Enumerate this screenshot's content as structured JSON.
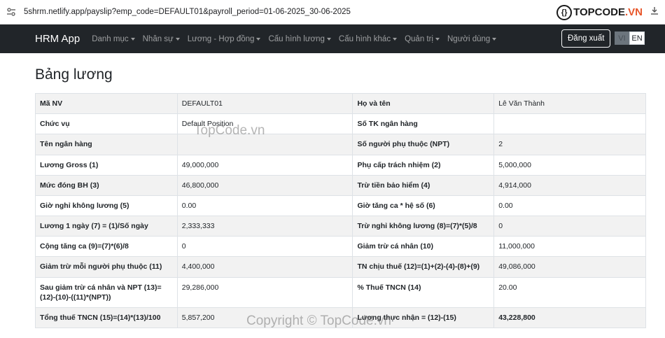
{
  "browser": {
    "url": "5shrm.netlify.app/payslip?emp_code=DEFAULT01&payroll_period=01-06-2025_30-06-2025"
  },
  "topcode_logo": {
    "text1": "TOPCODE",
    "text2": ".VN"
  },
  "navbar": {
    "brand": "HRM App",
    "items": [
      {
        "label": "Danh mục"
      },
      {
        "label": "Nhân sự"
      },
      {
        "label": "Lương - Hợp đồng"
      },
      {
        "label": "Cấu hình lương"
      },
      {
        "label": "Cấu hình khác"
      },
      {
        "label": "Quản trị"
      },
      {
        "label": "Người dùng"
      }
    ],
    "logout": "Đăng xuất",
    "lang_vi": "VI",
    "lang_en": "EN"
  },
  "page": {
    "title": "Bảng lương",
    "rows": [
      {
        "k1": "Mã NV",
        "v1": "DEFAULT01",
        "k2": "Họ và tên",
        "v2": "Lê Văn Thành"
      },
      {
        "k1": "Chức vụ",
        "v1": "Default Position",
        "k2": "Số TK ngân hàng",
        "v2": ""
      },
      {
        "k1": "Tên ngân hàng",
        "v1": "",
        "k2": "Số người phụ thuộc (NPT)",
        "v2": "2"
      },
      {
        "k1": "Lương Gross (1)",
        "v1": "49,000,000",
        "k2": "Phụ cấp trách nhiệm (2)",
        "v2": "5,000,000"
      },
      {
        "k1": "Mức đóng BH (3)",
        "v1": "46,800,000",
        "k2": "Trừ tiền bảo hiểm (4)",
        "v2": "4,914,000"
      },
      {
        "k1": "Giờ nghỉ không lương (5)",
        "v1": "0.00",
        "k2": "Giờ tăng ca * hệ số (6)",
        "v2": "0.00"
      },
      {
        "k1": "Lương 1 ngày (7) = (1)/Số ngày",
        "v1": "2,333,333",
        "k2": "Trừ nghỉ không lương (8)=(7)*(5)/8",
        "v2": "0"
      },
      {
        "k1": "Cộng tăng ca (9)=(7)*(6)/8",
        "v1": "0",
        "k2": "Giảm trừ cá nhân (10)",
        "v2": "11,000,000"
      },
      {
        "k1": "Giảm trừ mỗi người phụ thuộc (11)",
        "v1": "4,400,000",
        "k2": "TN chịu thuế (12)=(1)+(2)-(4)-(8)+(9)",
        "v2": "49,086,000"
      },
      {
        "k1": "Sau giảm trừ cá nhân và NPT (13)=(12)-(10)-((11)*(NPT))",
        "v1": "29,286,000",
        "k2": "% Thuế TNCN (14)",
        "v2": "20.00"
      },
      {
        "k1": "Tổng thuế TNCN (15)=(14)*(13)/100",
        "v1": "5,857,200",
        "k2": "Lương thực nhận = (12)-(15)",
        "v2": "43,228,800"
      }
    ]
  },
  "watermarks": {
    "center": "TopCode.vn",
    "bottom": "Copyright © TopCode.vn"
  }
}
